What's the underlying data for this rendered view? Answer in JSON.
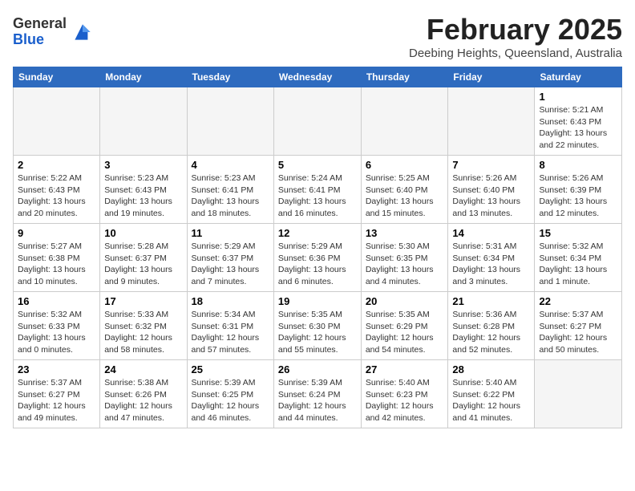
{
  "logo": {
    "general": "General",
    "blue": "Blue"
  },
  "title": "February 2025",
  "subtitle": "Deebing Heights, Queensland, Australia",
  "days_of_week": [
    "Sunday",
    "Monday",
    "Tuesday",
    "Wednesday",
    "Thursday",
    "Friday",
    "Saturday"
  ],
  "weeks": [
    [
      {
        "day": "",
        "info": ""
      },
      {
        "day": "",
        "info": ""
      },
      {
        "day": "",
        "info": ""
      },
      {
        "day": "",
        "info": ""
      },
      {
        "day": "",
        "info": ""
      },
      {
        "day": "",
        "info": ""
      },
      {
        "day": "1",
        "info": "Sunrise: 5:21 AM\nSunset: 6:43 PM\nDaylight: 13 hours\nand 22 minutes."
      }
    ],
    [
      {
        "day": "2",
        "info": "Sunrise: 5:22 AM\nSunset: 6:43 PM\nDaylight: 13 hours\nand 20 minutes."
      },
      {
        "day": "3",
        "info": "Sunrise: 5:23 AM\nSunset: 6:43 PM\nDaylight: 13 hours\nand 19 minutes."
      },
      {
        "day": "4",
        "info": "Sunrise: 5:23 AM\nSunset: 6:41 PM\nDaylight: 13 hours\nand 18 minutes."
      },
      {
        "day": "5",
        "info": "Sunrise: 5:24 AM\nSunset: 6:41 PM\nDaylight: 13 hours\nand 16 minutes."
      },
      {
        "day": "6",
        "info": "Sunrise: 5:25 AM\nSunset: 6:40 PM\nDaylight: 13 hours\nand 15 minutes."
      },
      {
        "day": "7",
        "info": "Sunrise: 5:26 AM\nSunset: 6:40 PM\nDaylight: 13 hours\nand 13 minutes."
      },
      {
        "day": "8",
        "info": "Sunrise: 5:26 AM\nSunset: 6:39 PM\nDaylight: 13 hours\nand 12 minutes."
      }
    ],
    [
      {
        "day": "9",
        "info": "Sunrise: 5:27 AM\nSunset: 6:38 PM\nDaylight: 13 hours\nand 10 minutes."
      },
      {
        "day": "10",
        "info": "Sunrise: 5:28 AM\nSunset: 6:37 PM\nDaylight: 13 hours\nand 9 minutes."
      },
      {
        "day": "11",
        "info": "Sunrise: 5:29 AM\nSunset: 6:37 PM\nDaylight: 13 hours\nand 7 minutes."
      },
      {
        "day": "12",
        "info": "Sunrise: 5:29 AM\nSunset: 6:36 PM\nDaylight: 13 hours\nand 6 minutes."
      },
      {
        "day": "13",
        "info": "Sunrise: 5:30 AM\nSunset: 6:35 PM\nDaylight: 13 hours\nand 4 minutes."
      },
      {
        "day": "14",
        "info": "Sunrise: 5:31 AM\nSunset: 6:34 PM\nDaylight: 13 hours\nand 3 minutes."
      },
      {
        "day": "15",
        "info": "Sunrise: 5:32 AM\nSunset: 6:34 PM\nDaylight: 13 hours\nand 1 minute."
      }
    ],
    [
      {
        "day": "16",
        "info": "Sunrise: 5:32 AM\nSunset: 6:33 PM\nDaylight: 13 hours\nand 0 minutes."
      },
      {
        "day": "17",
        "info": "Sunrise: 5:33 AM\nSunset: 6:32 PM\nDaylight: 12 hours\nand 58 minutes."
      },
      {
        "day": "18",
        "info": "Sunrise: 5:34 AM\nSunset: 6:31 PM\nDaylight: 12 hours\nand 57 minutes."
      },
      {
        "day": "19",
        "info": "Sunrise: 5:35 AM\nSunset: 6:30 PM\nDaylight: 12 hours\nand 55 minutes."
      },
      {
        "day": "20",
        "info": "Sunrise: 5:35 AM\nSunset: 6:29 PM\nDaylight: 12 hours\nand 54 minutes."
      },
      {
        "day": "21",
        "info": "Sunrise: 5:36 AM\nSunset: 6:28 PM\nDaylight: 12 hours\nand 52 minutes."
      },
      {
        "day": "22",
        "info": "Sunrise: 5:37 AM\nSunset: 6:27 PM\nDaylight: 12 hours\nand 50 minutes."
      }
    ],
    [
      {
        "day": "23",
        "info": "Sunrise: 5:37 AM\nSunset: 6:27 PM\nDaylight: 12 hours\nand 49 minutes."
      },
      {
        "day": "24",
        "info": "Sunrise: 5:38 AM\nSunset: 6:26 PM\nDaylight: 12 hours\nand 47 minutes."
      },
      {
        "day": "25",
        "info": "Sunrise: 5:39 AM\nSunset: 6:25 PM\nDaylight: 12 hours\nand 46 minutes."
      },
      {
        "day": "26",
        "info": "Sunrise: 5:39 AM\nSunset: 6:24 PM\nDaylight: 12 hours\nand 44 minutes."
      },
      {
        "day": "27",
        "info": "Sunrise: 5:40 AM\nSunset: 6:23 PM\nDaylight: 12 hours\nand 42 minutes."
      },
      {
        "day": "28",
        "info": "Sunrise: 5:40 AM\nSunset: 6:22 PM\nDaylight: 12 hours\nand 41 minutes."
      },
      {
        "day": "",
        "info": ""
      }
    ]
  ]
}
